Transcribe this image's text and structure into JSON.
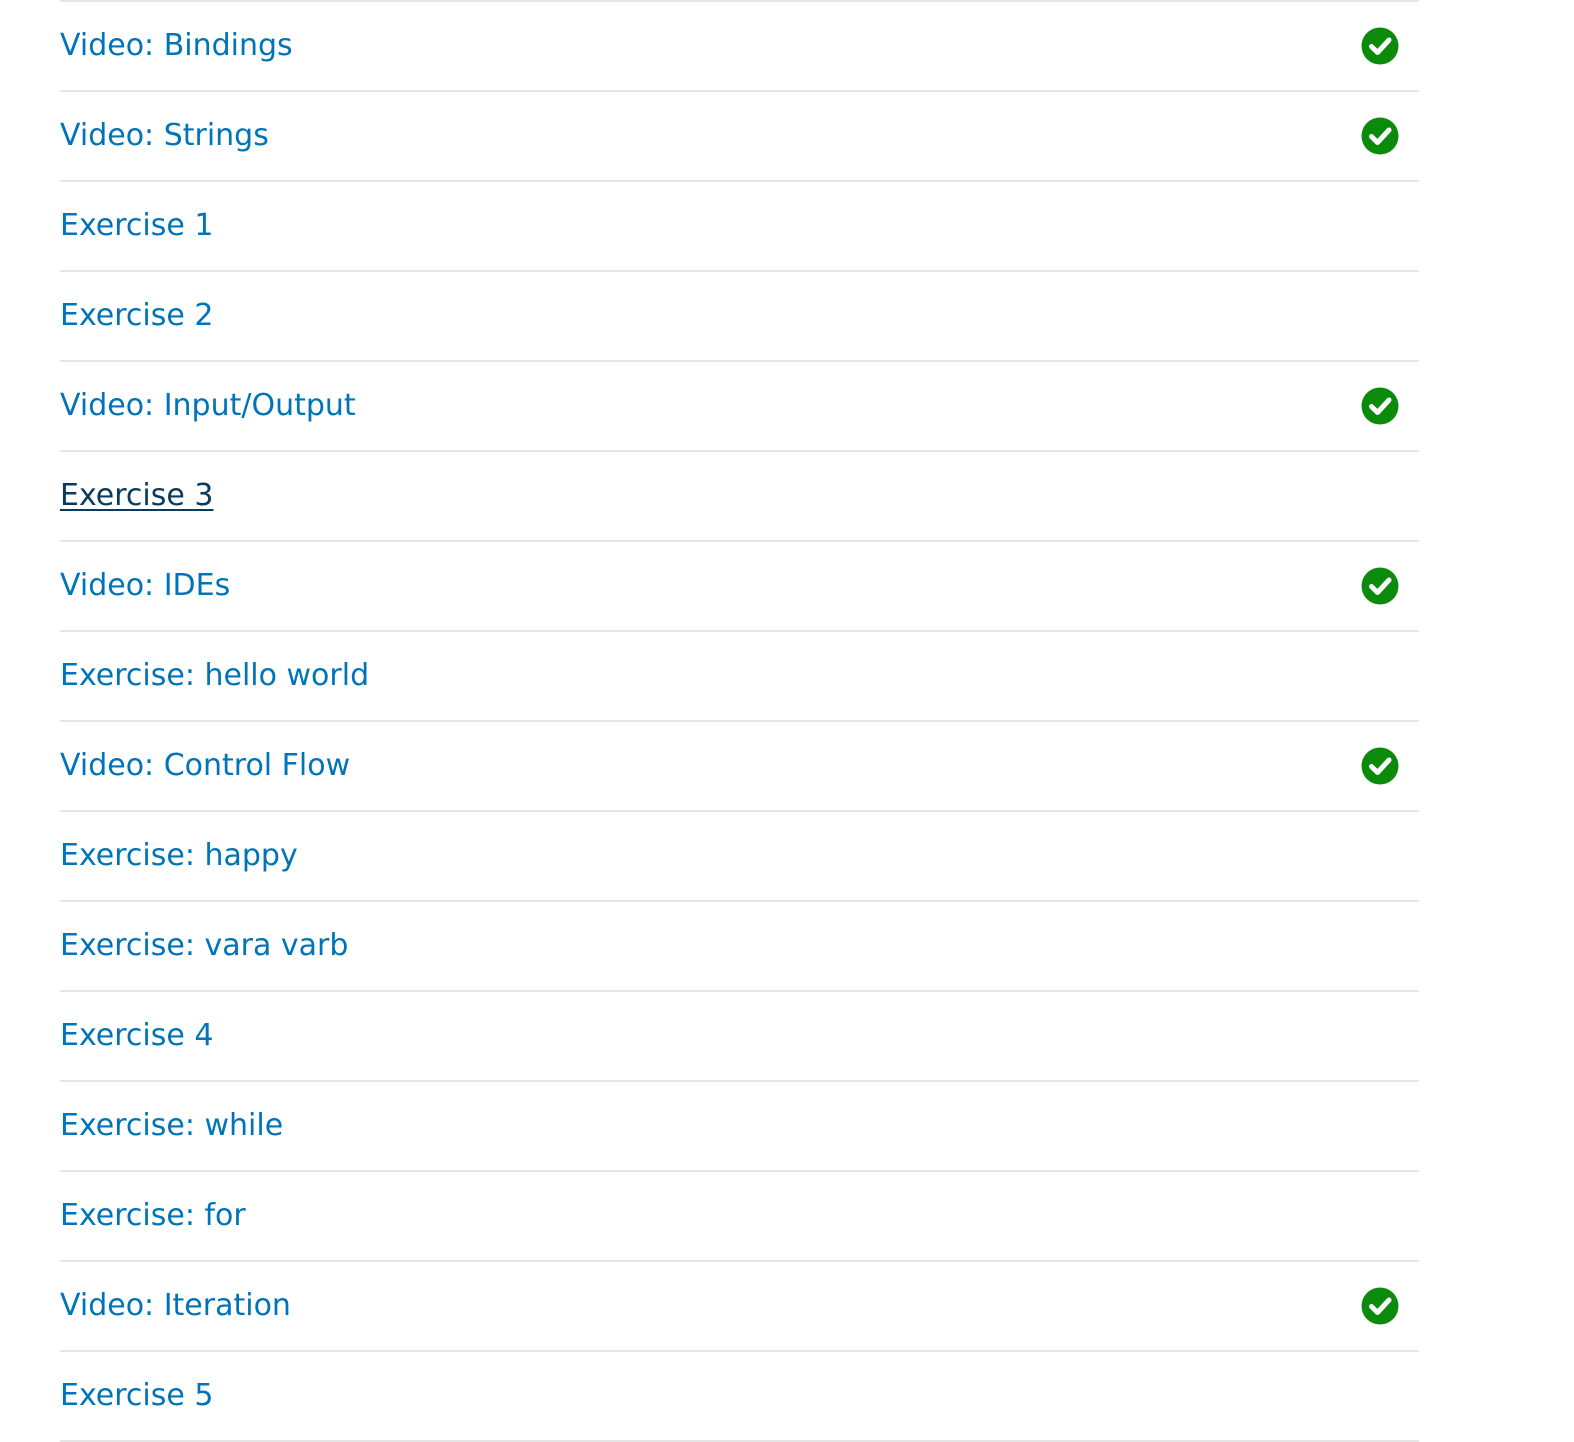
{
  "colors": {
    "link": "#0074b8",
    "link_hover": "#0a3a5c",
    "divider": "#e6e6e6",
    "complete_icon": "#0b8a0b"
  },
  "lessons": [
    {
      "label": "Video: Bindings",
      "completed": true,
      "hovered": false
    },
    {
      "label": "Video: Strings",
      "completed": true,
      "hovered": false
    },
    {
      "label": "Exercise 1",
      "completed": false,
      "hovered": false
    },
    {
      "label": "Exercise 2",
      "completed": false,
      "hovered": false
    },
    {
      "label": "Video: Input/Output",
      "completed": true,
      "hovered": false
    },
    {
      "label": "Exercise 3",
      "completed": false,
      "hovered": true
    },
    {
      "label": "Video: IDEs",
      "completed": true,
      "hovered": false
    },
    {
      "label": "Exercise: hello world",
      "completed": false,
      "hovered": false
    },
    {
      "label": "Video: Control Flow",
      "completed": true,
      "hovered": false
    },
    {
      "label": "Exercise: happy",
      "completed": false,
      "hovered": false
    },
    {
      "label": "Exercise: vara varb",
      "completed": false,
      "hovered": false
    },
    {
      "label": "Exercise 4",
      "completed": false,
      "hovered": false
    },
    {
      "label": "Exercise: while",
      "completed": false,
      "hovered": false
    },
    {
      "label": "Exercise: for",
      "completed": false,
      "hovered": false
    },
    {
      "label": "Video: Iteration",
      "completed": true,
      "hovered": false
    },
    {
      "label": "Exercise 5",
      "completed": false,
      "hovered": false
    }
  ]
}
